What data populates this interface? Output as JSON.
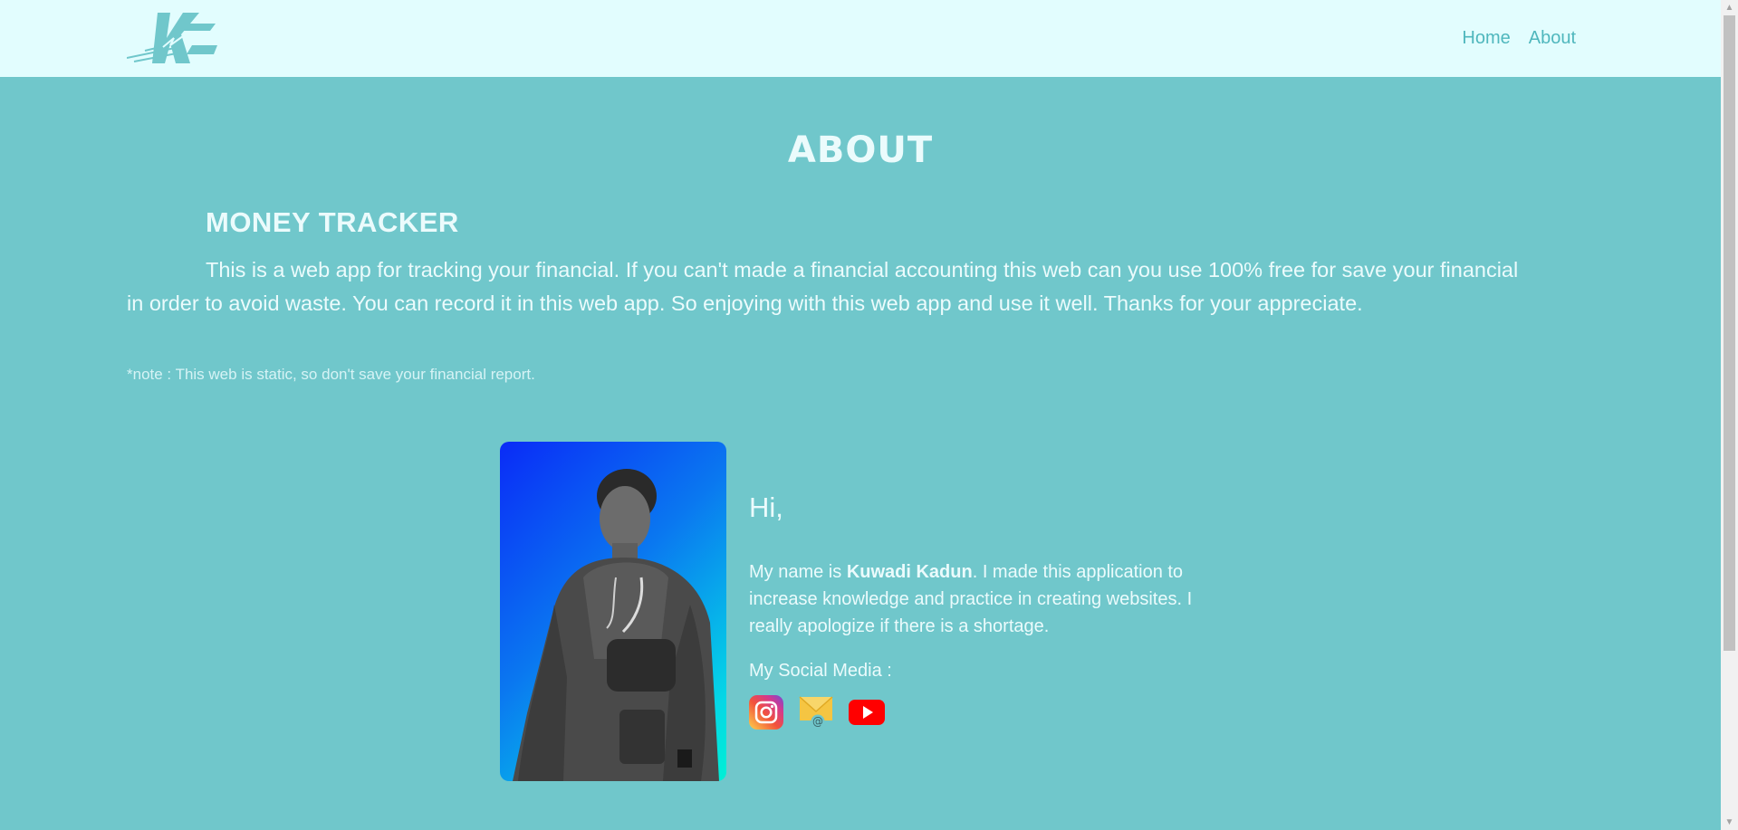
{
  "nav": {
    "logo_icon": "kd-brand-logo-icon",
    "links": [
      "Home",
      "About"
    ]
  },
  "page": {
    "title": "ABOUT",
    "section_title": "MONEY TRACKER",
    "description": "This is a web app for tracking your financial. If you can't made a financial accounting this web can you use 100% free for save your financial in order to avoid waste. You can record it in this web app. So enjoying with this web app and use it well. Thanks for your appreciate.",
    "note": "*note : This web is static, so don't save your financial report."
  },
  "profile": {
    "greeting": "Hi,",
    "bio_prefix": "My name is ",
    "bio_name": "Kuwadi Kadun",
    "bio_suffix": ". I made this application to increase knowledge and practice in creating websites. I really apologize if there is a shortage.",
    "social_label": "My Social Media :",
    "social_icons": [
      "instagram-icon",
      "email-icon",
      "youtube-icon"
    ]
  },
  "colors": {
    "background": "#70c7cb",
    "navbar": "#e2fdfe",
    "nav_link": "#4fb7bd",
    "text": "#ebfbfc"
  }
}
